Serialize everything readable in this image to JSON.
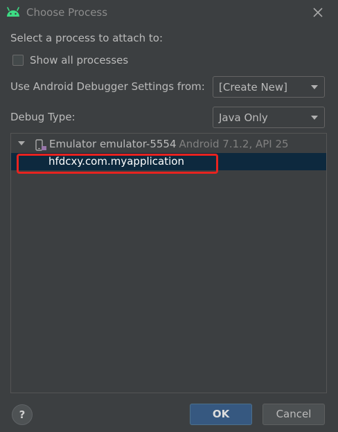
{
  "window": {
    "title": "Choose Process",
    "app_icon": "android-icon",
    "close_icon": "close-icon"
  },
  "prompt": "Select a process to attach to:",
  "show_all": {
    "label": "Show all processes",
    "checked": false
  },
  "debugger_settings": {
    "label": "Use Android Debugger Settings from:",
    "value": "[Create New]"
  },
  "debug_type": {
    "label": "Debug Type:",
    "value": "Java Only"
  },
  "tree": {
    "device": {
      "name": "Emulator emulator-5554",
      "detail": "Android 7.1.2, API 25",
      "icon": "device-icon",
      "expanded": true
    },
    "processes": [
      {
        "name": "hfdcxy.com.myapplication",
        "selected": true
      }
    ]
  },
  "buttons": {
    "help": "?",
    "ok": "OK",
    "cancel": "Cancel"
  },
  "colors": {
    "background": "#3c3f41",
    "selection": "#0d293e",
    "ok_button": "#365880",
    "annotation_box": "#e8231f",
    "android_green": "#3ddc84"
  }
}
